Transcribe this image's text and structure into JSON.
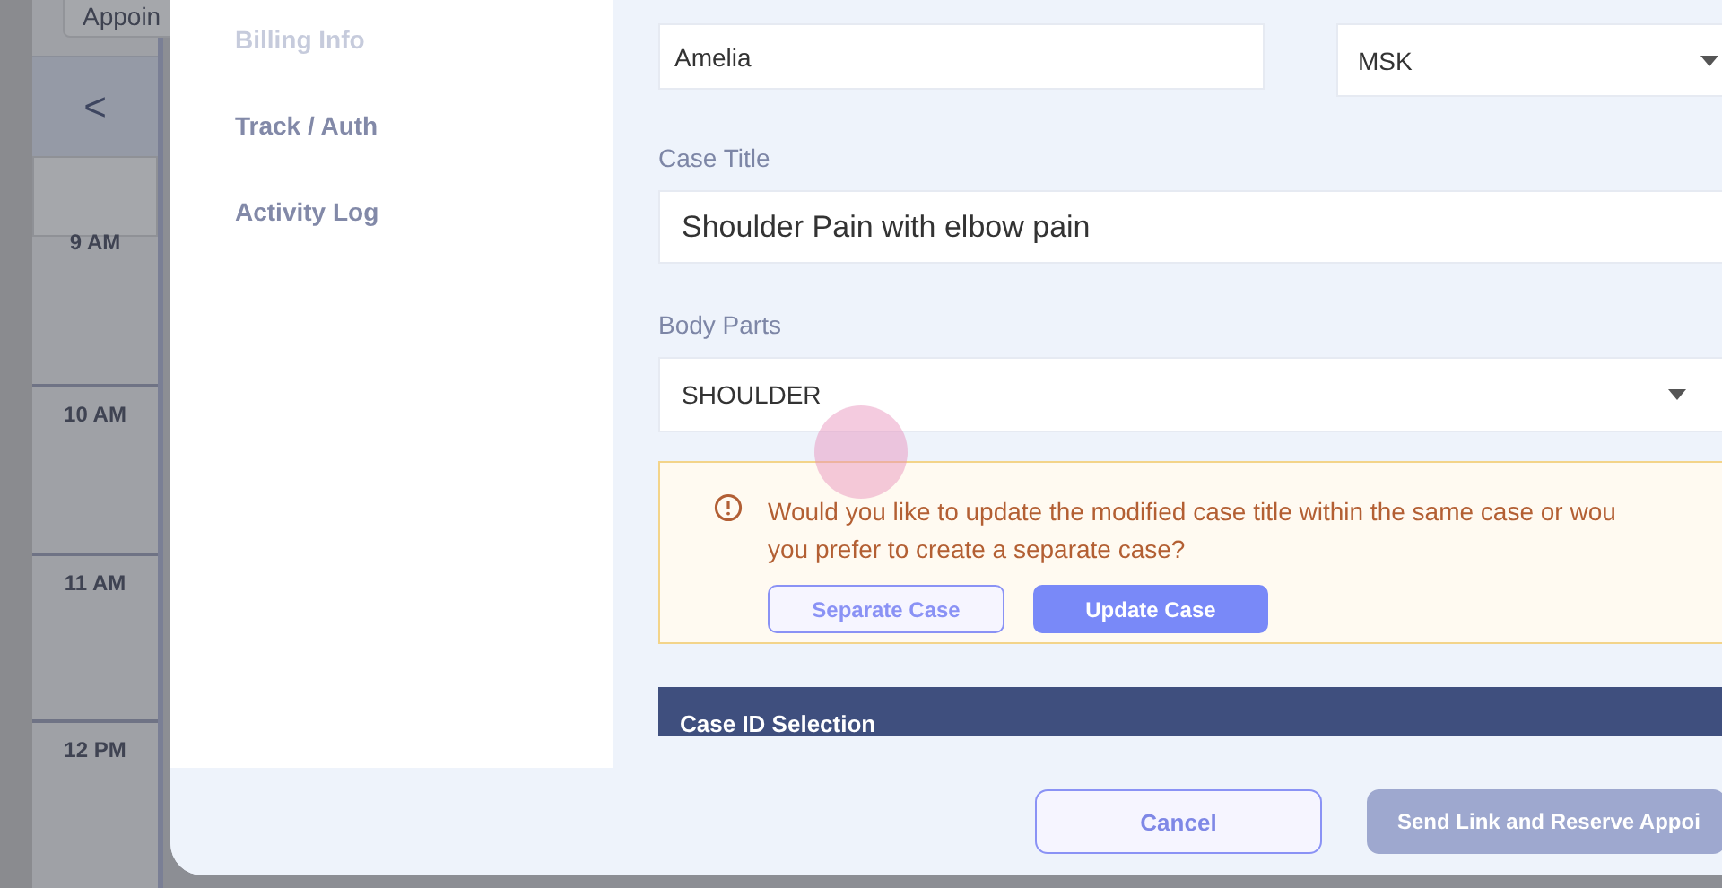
{
  "background": {
    "button_label": "Appoin",
    "nav_arrow": "<",
    "times": [
      "9 AM",
      "10 AM",
      "11 AM",
      "12 PM"
    ]
  },
  "modal": {
    "nav_items": [
      {
        "label": "Billing Info",
        "disabled": true
      },
      {
        "label": "Track / Auth",
        "disabled": false
      },
      {
        "label": "Activity Log",
        "disabled": false
      }
    ],
    "first_name": {
      "value": "Amelia"
    },
    "category": {
      "value": "MSK"
    },
    "case_title": {
      "label": "Case Title",
      "value": "Shoulder Pain with elbow pain"
    },
    "body_parts": {
      "label": "Body Parts",
      "value": "SHOULDER"
    },
    "alert": {
      "message": "Would you like to update the modified case title within the same case or wou",
      "message_line_2": "you prefer to create a separate case?",
      "buttons": [
        {
          "label": "Separate Case",
          "kind": "outline"
        },
        {
          "label": "Update Case",
          "kind": "primary"
        }
      ]
    },
    "section_header": "Case ID Selection",
    "footer_buttons": [
      {
        "label": "Cancel",
        "disabled": false,
        "kind": "outline"
      },
      {
        "label": "Send Link and Reserve Appoi",
        "disabled": true,
        "kind": "primary"
      }
    ]
  }
}
